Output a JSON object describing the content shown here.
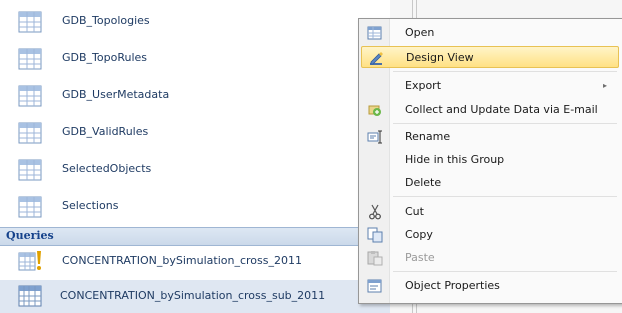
{
  "nav": {
    "tables": [
      {
        "label": "GDB_Topologies"
      },
      {
        "label": "GDB_TopoRules"
      },
      {
        "label": "GDB_UserMetadata"
      },
      {
        "label": "GDB_ValidRules"
      },
      {
        "label": "SelectedObjects"
      },
      {
        "label": "Selections"
      }
    ],
    "group_header": "Queries",
    "queries": [
      {
        "label": "CONCENTRATION_bySimulation_cross_2011"
      },
      {
        "label": "CONCENTRATION_bySimulation_cross_sub_2011"
      }
    ]
  },
  "context_menu": {
    "open": "Open",
    "design_view": "Design View",
    "export": "Export",
    "collect": "Collect and Update Data via E-mail",
    "rename": "Rename",
    "hide": "Hide in this Group",
    "delete": "Delete",
    "cut": "Cut",
    "copy": "Copy",
    "paste": "Paste",
    "object_properties": "Object Properties",
    "submenu_arrow": "▸"
  },
  "colors": {
    "group_header": "#15428b",
    "highlight": "#ffe184",
    "selection": "#dfe7f2"
  }
}
